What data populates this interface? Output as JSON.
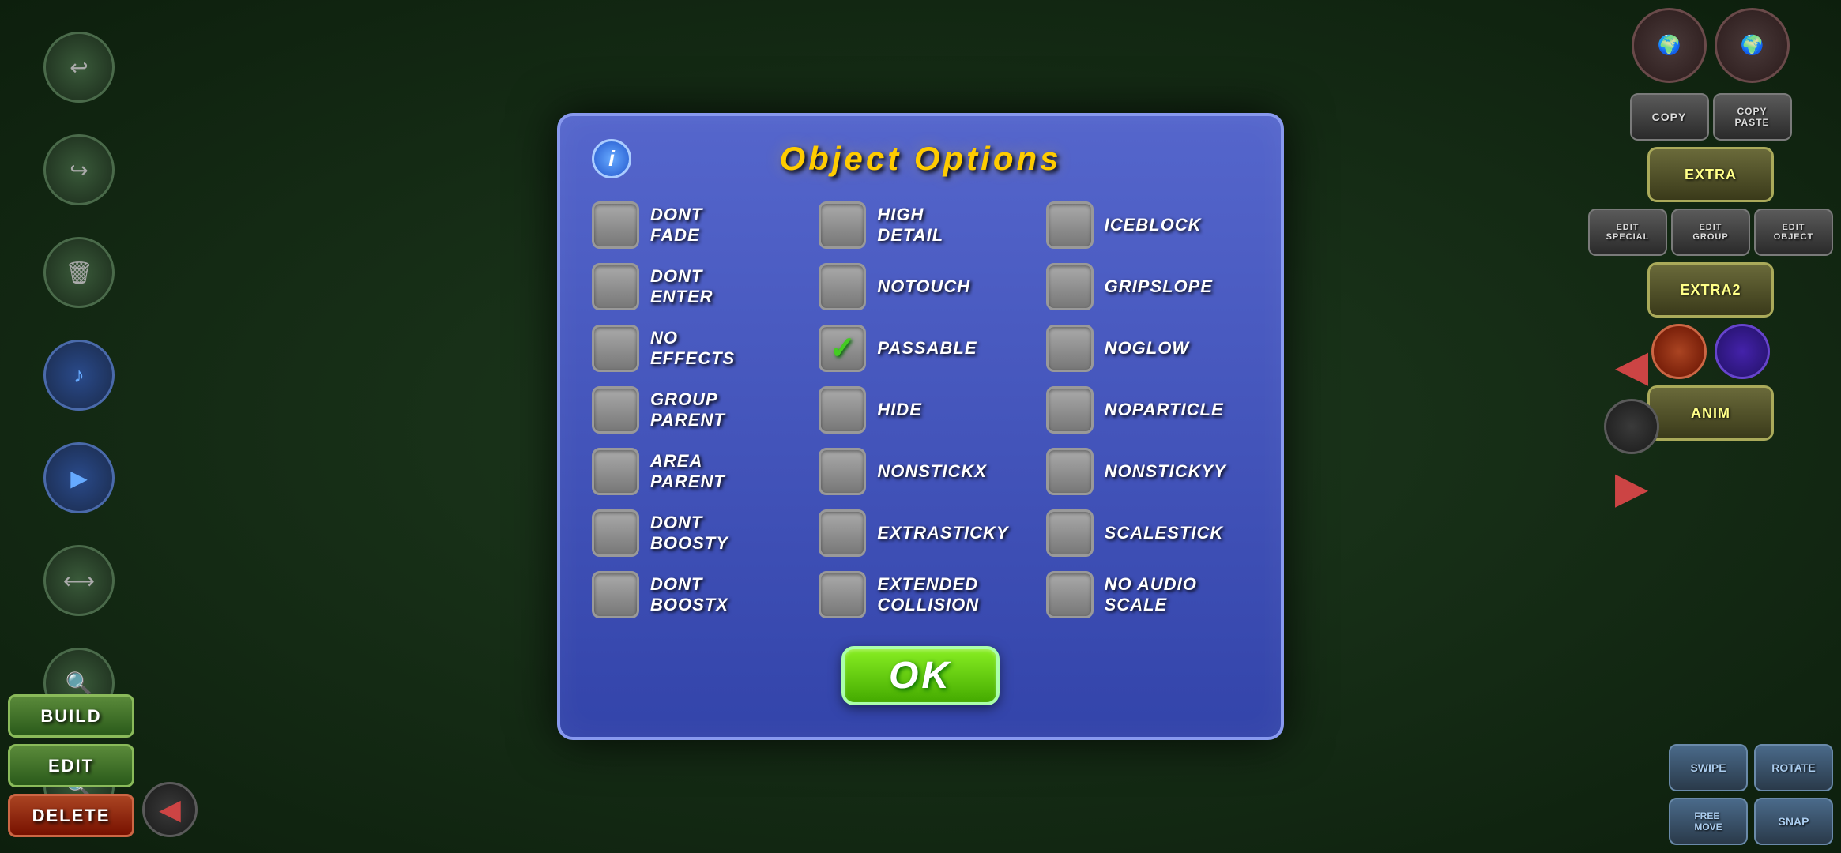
{
  "modal": {
    "title": "Object Options",
    "info_icon": "ℹ",
    "ok_label": "OK"
  },
  "options": [
    {
      "id": "dont-fade",
      "label": "Dont\nFade",
      "checked": false
    },
    {
      "id": "high-detail",
      "label": "High\nDetail",
      "checked": false
    },
    {
      "id": "iceblock",
      "label": "IceBlock",
      "checked": false
    },
    {
      "id": "dont-enter",
      "label": "Dont\nEnter",
      "checked": false
    },
    {
      "id": "notouch",
      "label": "NoTouch",
      "checked": false
    },
    {
      "id": "gripslope",
      "label": "GripSlope",
      "checked": false
    },
    {
      "id": "no-effects",
      "label": "No\nEffects",
      "checked": false
    },
    {
      "id": "passable",
      "label": "Passable",
      "checked": true
    },
    {
      "id": "noglow",
      "label": "NoGlow",
      "checked": false
    },
    {
      "id": "group-parent",
      "label": "Group\nParent",
      "checked": false
    },
    {
      "id": "hide",
      "label": "Hide",
      "checked": false
    },
    {
      "id": "noparticle",
      "label": "NoParticle",
      "checked": false
    },
    {
      "id": "area-parent",
      "label": "Area\nParent",
      "checked": false
    },
    {
      "id": "nonstickx",
      "label": "NonStickX",
      "checked": false
    },
    {
      "id": "nonsticky",
      "label": "NonStickyY",
      "checked": false
    },
    {
      "id": "dont-boosty",
      "label": "Dont\nBoostY",
      "checked": false
    },
    {
      "id": "extrasticky",
      "label": "ExtraSticky",
      "checked": false
    },
    {
      "id": "scalestick",
      "label": "ScaleStick",
      "checked": false
    },
    {
      "id": "dont-boostx",
      "label": "Dont\nBoostX",
      "checked": false
    },
    {
      "id": "extended-collision",
      "label": "Extended\nCollision",
      "checked": false
    },
    {
      "id": "no-audio-scale",
      "label": "No Audio\nScale",
      "checked": false
    }
  ],
  "left_buttons": [
    "↩",
    "↪",
    "🗑",
    "♪▶",
    "▶",
    "⟷",
    "🔍",
    "🔍"
  ],
  "bottom_left_tabs": [
    "BUILD",
    "EDIT",
    "DELETE"
  ],
  "right_edit_buttons": [
    "COPY",
    "COPY\nPASTE",
    "EXTRA",
    "EDIT\nSPECIAL",
    "EDIT\nGROUP",
    "EDIT\nOBJECT",
    "EXTRA2",
    "ANIM"
  ],
  "bottom_right_buttons": [
    "SWIPE",
    "ROTATE",
    "FREE\nMOVE",
    "SNAP"
  ],
  "colors": {
    "modal_bg": "#4455bb",
    "title": "#ffcc00",
    "checkbox_bg": "#999999",
    "checkbox_checked": "#44cc22",
    "ok_bg": "#66dd11"
  }
}
